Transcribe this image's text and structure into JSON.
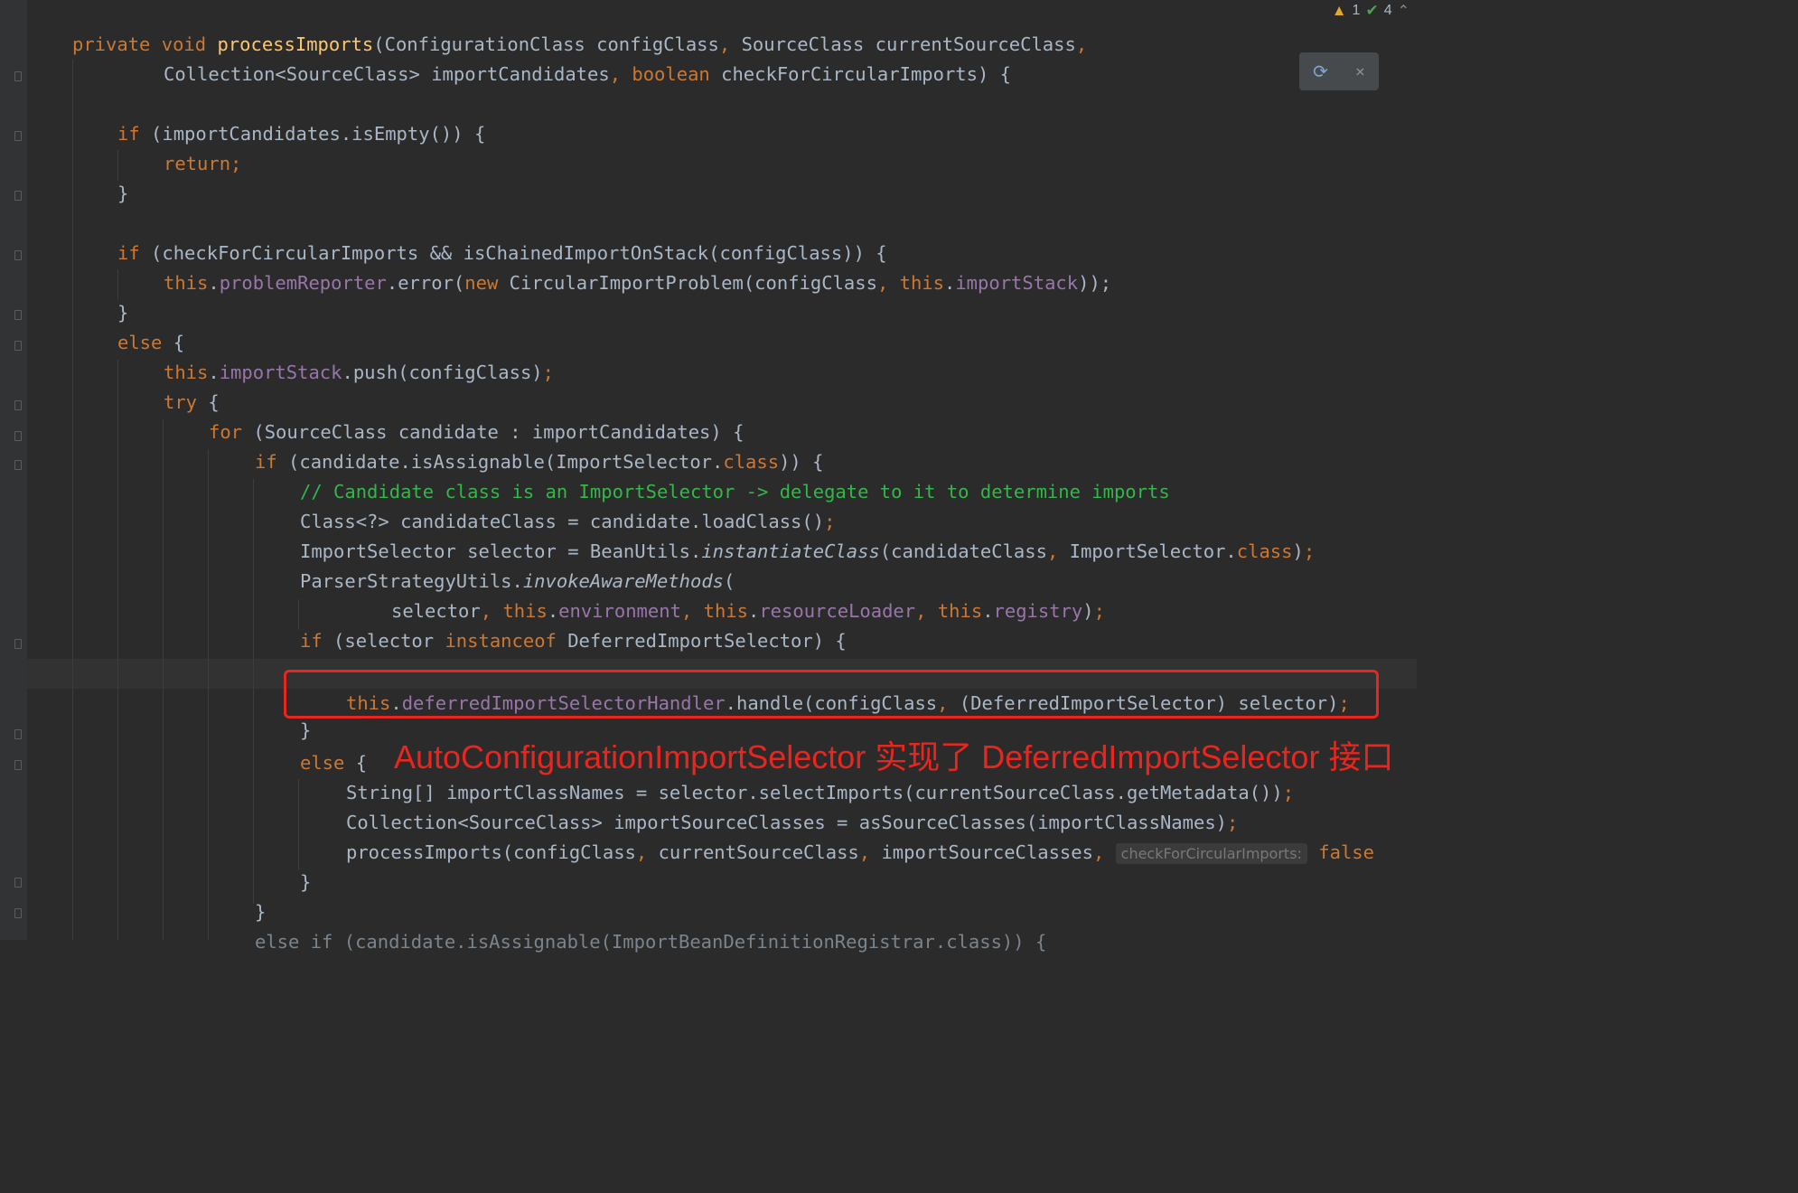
{
  "status": {
    "warning_count": "1",
    "ok_count": "4"
  },
  "popup": {
    "close_label": "×"
  },
  "annotation": "AutoConfigurationImportSelector 实现了 DeferredImportSelector 接口",
  "code": {
    "l1": [
      "private",
      "void",
      "processImports",
      "(ConfigurationClass configClass",
      ", ",
      "SourceClass currentSourceClass",
      ","
    ],
    "l2": [
      "Collection<SourceClass> importCandidates",
      ", ",
      "boolean",
      " checkForCircularImports) {"
    ],
    "l4": [
      "if",
      " (importCandidates.isEmpty()) {"
    ],
    "l5": [
      "return;"
    ],
    "l6": [
      "}"
    ],
    "l8": [
      "if",
      " (checkForCircularImports && isChainedImportOnStack(configClass)) {"
    ],
    "l9": [
      "this",
      ".",
      "problemReporter",
      ".error(",
      "new",
      " CircularImportProblem(configClass",
      ", ",
      "this",
      ".",
      "importStack",
      "));"
    ],
    "l10": [
      "}"
    ],
    "l11": [
      "else",
      " {"
    ],
    "l12": [
      "this",
      ".",
      "importStack",
      ".push(configClass)",
      ";"
    ],
    "l13": [
      "try",
      " {"
    ],
    "l14": [
      "for",
      " (SourceClass candidate : importCandidates) {"
    ],
    "l15": [
      "if",
      " (candidate.isAssignable(ImportSelector.",
      "class",
      ")) {"
    ],
    "l16": [
      "// Candidate class is an ImportSelector -> delegate to it to determine imports"
    ],
    "l17": [
      "Class<?> candidateClass = candidate.loadClass()",
      ";"
    ],
    "l18": [
      "ImportSelector selector = BeanUtils.",
      "instantiateClass",
      "(candidateClass",
      ", ",
      "ImportSelector.",
      "class",
      ")",
      ";"
    ],
    "l19": [
      "ParserStrategyUtils.",
      "invokeAwareMethods",
      "("
    ],
    "l20": [
      "selector",
      ", ",
      "this",
      ".",
      "environment",
      ", ",
      "this",
      ".",
      "resourceLoader",
      ", ",
      "this",
      ".",
      "registry",
      ")",
      ";"
    ],
    "l21": [
      "if",
      " (selector ",
      "instanceof",
      " DeferredImportSelector) {"
    ],
    "l23": [
      "this",
      ".",
      "deferredImportSelectorHandler",
      ".handle(configClass",
      ", ",
      "(DeferredImportSelector) selector)",
      ";"
    ],
    "l24": [
      "}"
    ],
    "l25": [
      "else",
      " {"
    ],
    "l26": [
      "String[] importClassNames = selector.selectImports(currentSourceClass.getMetadata())",
      ";"
    ],
    "l27": [
      "Collection<SourceClass> importSourceClasses = asSourceClasses(importClassNames)",
      ";"
    ],
    "l28": [
      "processImports(configClass",
      ", ",
      "currentSourceClass",
      ", ",
      "importSourceClasses",
      ", "
    ],
    "l28_hint": "checkForCircularImports:",
    "l28_tail": "false",
    "l29": [
      "}"
    ],
    "l30": [
      "}"
    ],
    "l31": [
      "else if (candidate.isAssignable(ImportBeanDefinitionRegistrar.class)) {"
    ]
  }
}
